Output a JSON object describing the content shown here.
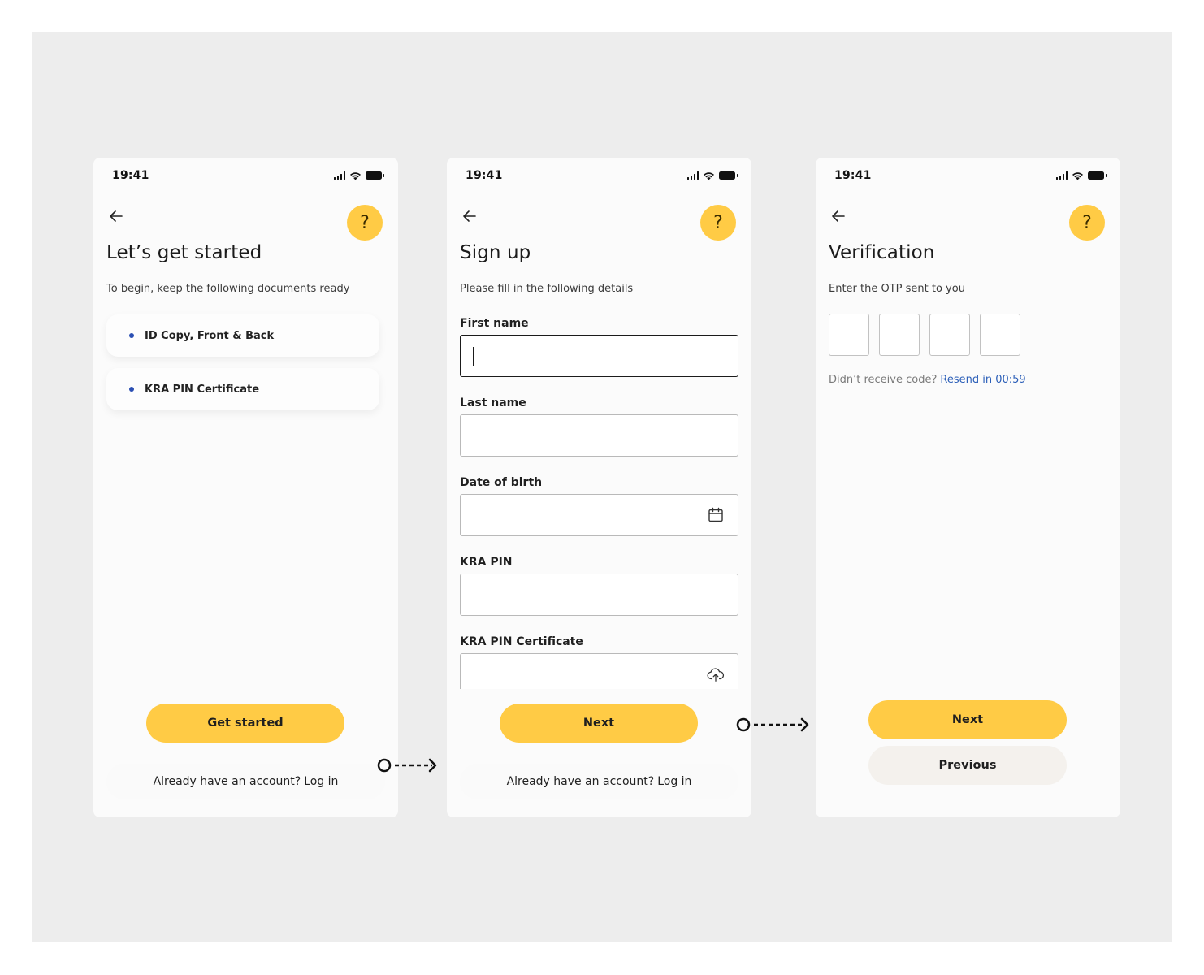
{
  "screens": {
    "start": {
      "status_time": "19:41",
      "help_label": "?",
      "title": "Let’s get started",
      "subtitle": "To begin, keep the following documents ready",
      "documents": [
        {
          "label": "ID Copy, Front & Back"
        },
        {
          "label": "KRA PIN Certificate"
        }
      ],
      "primary_button": "Get started",
      "login_prompt": "Already have an account?",
      "login_link": "Log in"
    },
    "signup": {
      "status_time": "19:41",
      "help_label": "?",
      "title": "Sign up",
      "subtitle": "Please fill in the following details",
      "fields": [
        {
          "label": "First name",
          "value": ""
        },
        {
          "label": "Last name",
          "value": ""
        },
        {
          "label": "Date of birth",
          "value": "",
          "icon": "calendar-icon"
        },
        {
          "label": "KRA PIN",
          "value": ""
        },
        {
          "label": "KRA PIN Certificate",
          "value": "",
          "icon": "cloud-upload-icon"
        }
      ],
      "primary_button": "Next",
      "login_prompt": "Already have an account?",
      "login_link": "Log in"
    },
    "verification": {
      "status_time": "19:41",
      "help_label": "?",
      "title": "Verification",
      "subtitle": "Enter the OTP sent to you",
      "otp_digits": [
        "",
        "",
        "",
        ""
      ],
      "resend_prompt": "Didn’t receive code?",
      "resend_link": "Resend in 00:59",
      "primary_button": "Next",
      "secondary_button": "Previous"
    }
  },
  "colors": {
    "accent": "#ffcb45",
    "canvas": "#ededed",
    "screen": "#fbfbfb",
    "bullet": "#2b4fb3",
    "link": "#2c5fb8"
  }
}
